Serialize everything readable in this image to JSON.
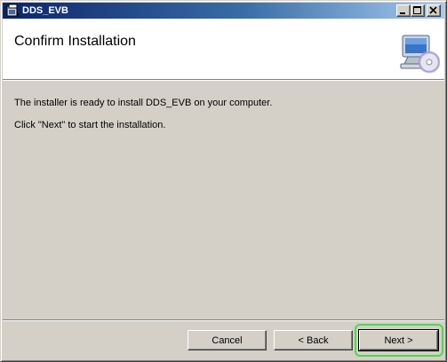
{
  "window": {
    "title": "DDS_EVB",
    "controls": {
      "minimize": "minimize",
      "maximize": "maximize",
      "close": "close"
    }
  },
  "banner": {
    "title": "Confirm Installation",
    "icon": "computer-cd-icon"
  },
  "content": {
    "line1": "The installer is ready to install DDS_EVB on your computer.",
    "line2": "Click \"Next\" to start the installation."
  },
  "buttons": {
    "cancel": "Cancel",
    "back": "< Back",
    "next": "Next >"
  },
  "colors": {
    "titlebar_start": "#0a246a",
    "titlebar_end": "#a6caf0",
    "dialog_face": "#d4d0c8",
    "highlight": "#4cd94c"
  }
}
